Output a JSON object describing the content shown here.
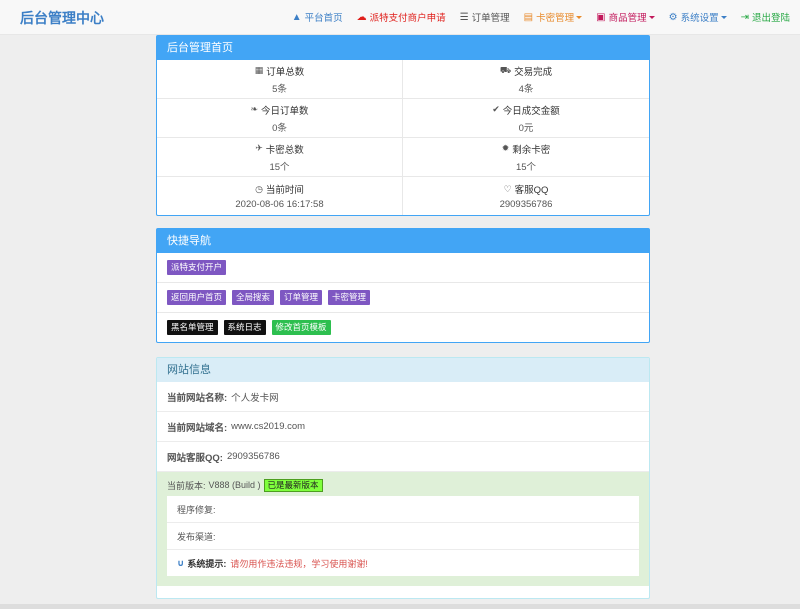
{
  "navbar": {
    "brand": "后台管理中心",
    "items": [
      {
        "label": "平台首页",
        "color": "#3c7fc6",
        "icon": "user-icon",
        "glyph": "▲",
        "dropdown": false
      },
      {
        "label": "派特支付商户申请",
        "color": "#e0201c",
        "icon": "cloud-icon",
        "glyph": "☁",
        "dropdown": false
      },
      {
        "label": "订单管理",
        "color": "#555555",
        "icon": "list-icon",
        "glyph": "☰",
        "dropdown": false
      },
      {
        "label": "卡密管理",
        "color": "#e88a2b",
        "icon": "card-icon",
        "glyph": "▤",
        "dropdown": true
      },
      {
        "label": "商品管理",
        "color": "#c2185b",
        "icon": "goods-icon",
        "glyph": "▣",
        "dropdown": true
      },
      {
        "label": "系统设置",
        "color": "#3c7fc6",
        "icon": "gear-icon",
        "glyph": "⚙",
        "dropdown": true
      },
      {
        "label": "退出登陆",
        "color": "#27a844",
        "icon": "logout-icon",
        "glyph": "⇥",
        "dropdown": false
      }
    ]
  },
  "dashboard": {
    "title": "后台管理首页",
    "stats": [
      {
        "label": "订单总数",
        "value": "5条",
        "icon": "grid-icon",
        "glyph": "▦"
      },
      {
        "label": "交易完成",
        "value": "4条",
        "icon": "cart-icon",
        "glyph": "⛟"
      },
      {
        "label": "今日订单数",
        "value": "0条",
        "icon": "leaf-icon",
        "glyph": "❧"
      },
      {
        "label": "今日成交金额",
        "value": "0元",
        "icon": "check-icon",
        "glyph": "✔"
      },
      {
        "label": "卡密总数",
        "value": "15个",
        "icon": "plane-icon",
        "glyph": "✈"
      },
      {
        "label": "剩余卡密",
        "value": "15个",
        "icon": "asterisk-icon",
        "glyph": "✹"
      },
      {
        "label": "当前时间",
        "value": "2020-08-06 16:17:58",
        "icon": "clock-icon",
        "glyph": "◷"
      },
      {
        "label": "客服QQ",
        "value": "2909356786",
        "icon": "heart-icon",
        "glyph": "♡"
      }
    ]
  },
  "quicknav": {
    "title": "快捷导航",
    "rows": [
      [
        {
          "label": "派特支付开户",
          "color": "#7e57c2"
        }
      ],
      [
        {
          "label": "返回用户首页",
          "color": "#7e57c2"
        },
        {
          "label": "全局搜索",
          "color": "#7e57c2"
        },
        {
          "label": "订单管理",
          "color": "#7e57c2"
        },
        {
          "label": "卡密管理",
          "color": "#7e57c2"
        }
      ],
      [
        {
          "label": "黑名单管理",
          "color": "#111111"
        },
        {
          "label": "系统日志",
          "color": "#111111"
        },
        {
          "label": "修改首页模板",
          "color": "#2dbf4f"
        }
      ]
    ]
  },
  "siteinfo": {
    "title": "网站信息",
    "rows": [
      {
        "key": "当前网站名称:",
        "value": "个人发卡网"
      },
      {
        "key": "当前网站域名:",
        "value": "www.cs2019.com"
      },
      {
        "key": "网站客服QQ:",
        "value": "2909356786"
      }
    ],
    "version_label": "当前版本:",
    "version_value": "V888 (Build )",
    "version_badge": "已是最新版本",
    "repair_label": "程序修复:",
    "channel_label": "发布渠道:",
    "tip_label": "系统提示:",
    "tip_text": "请勿用作违法违规，学习使用谢谢!"
  }
}
